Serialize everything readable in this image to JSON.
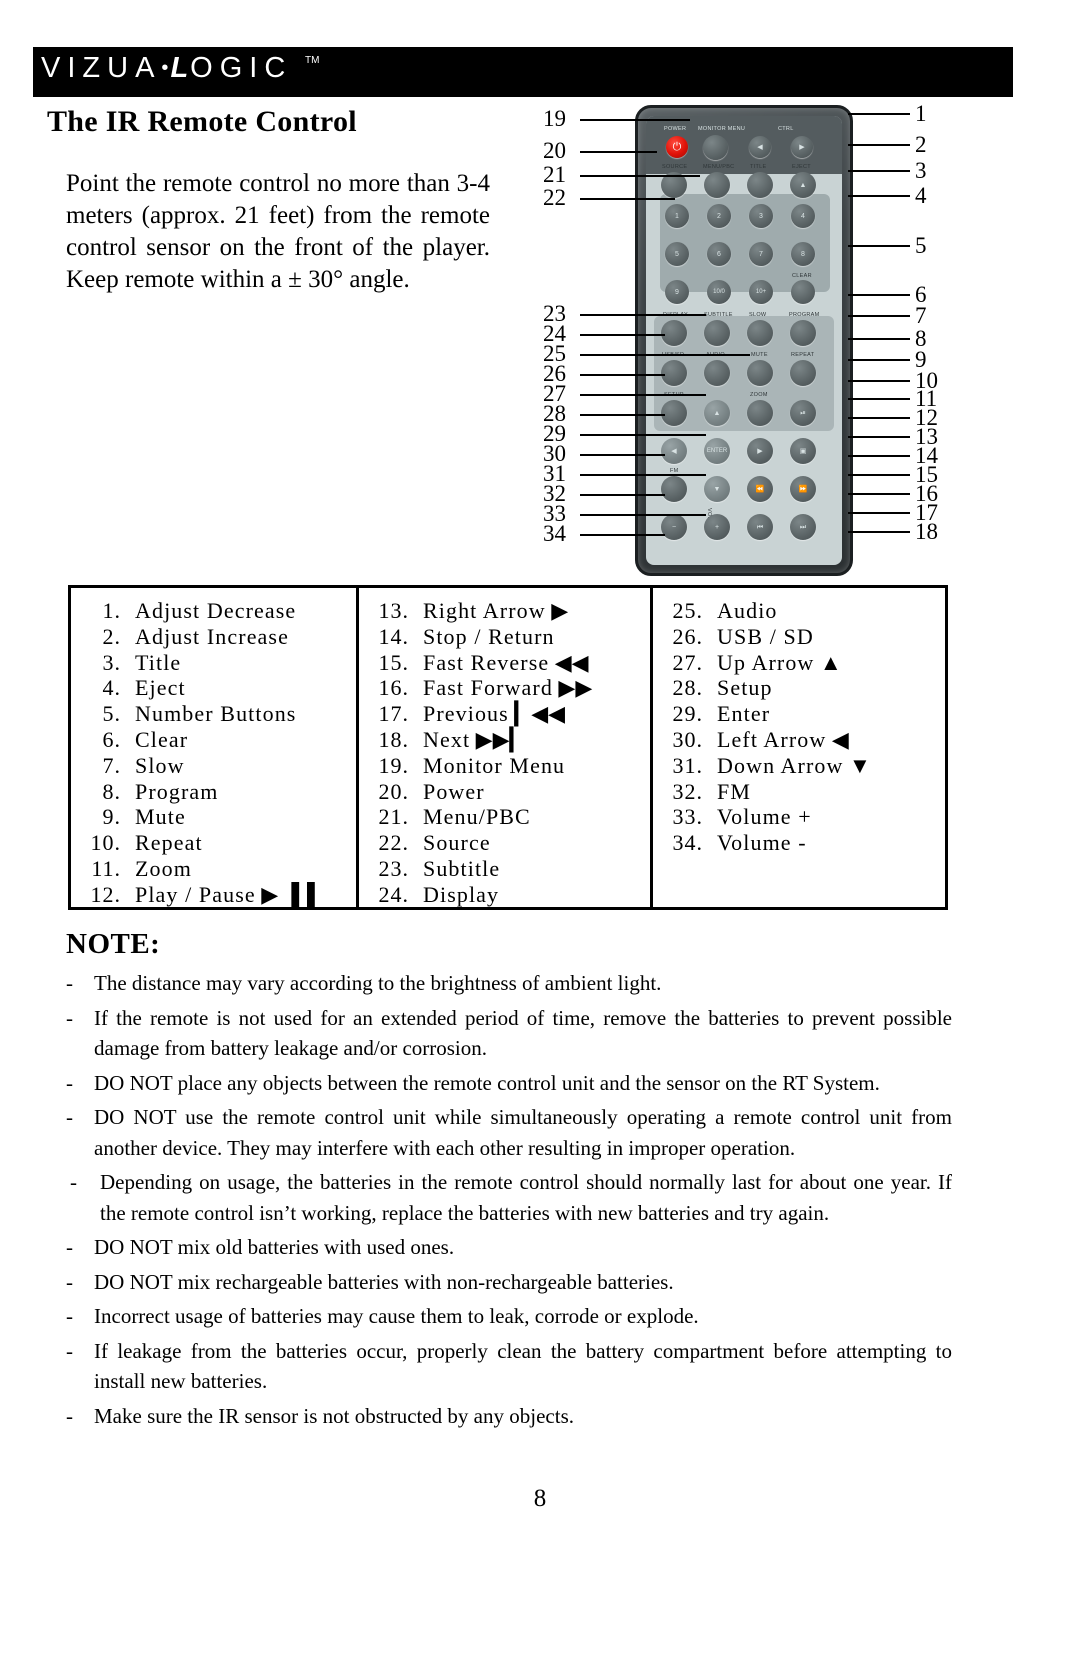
{
  "brand": {
    "logo_text": "V I Z U A L O G I C",
    "logo_letters": [
      "V",
      "I",
      "Z",
      "U",
      "A",
      "L",
      "O",
      "G",
      "I",
      "C"
    ],
    "trademark": "TM"
  },
  "header": {
    "title": "The IR Remote Control"
  },
  "intro": {
    "paragraph": "Point the remote control no more than 3-4 meters (approx. 21 feet) from the remote control sensor on the front of the player.  Keep remote within a ± 30° angle."
  },
  "diagram": {
    "name": "ir-remote-control-diagram",
    "right_callouts": [
      "1",
      "2",
      "3",
      "4",
      "5",
      "6",
      "7",
      "8",
      "9",
      "10",
      "11",
      "12",
      "13",
      "14",
      "15",
      "16",
      "17",
      "18"
    ],
    "left_callouts": [
      "19",
      "20",
      "21",
      "22",
      "23",
      "24",
      "25",
      "26",
      "27",
      "28",
      "29",
      "30",
      "31",
      "32",
      "33",
      "34"
    ],
    "button_labels": [
      "POWER",
      "MONITOR MENU",
      "CTRL",
      "SOURCE",
      "MENU/PBC",
      "TITLE",
      "EJECT",
      "CLEAR",
      "DISPLAY",
      "SUBTITLE",
      "SLOW",
      "PROGRAM",
      "USB/SD",
      "AUDIO",
      "MUTE",
      "REPEAT",
      "SETUP",
      "ZOOM",
      "ENTER",
      "FM",
      "VOL"
    ],
    "number_keys": [
      "1",
      "2",
      "3",
      "4",
      "5",
      "6",
      "7",
      "8",
      "9",
      "10/0",
      "10+"
    ]
  },
  "legend": {
    "columns": [
      {
        "items": [
          {
            "num": "1.",
            "label": "Adjust Decrease",
            "glyph": ""
          },
          {
            "num": "2.",
            "label": "Adjust Increase",
            "glyph": ""
          },
          {
            "num": "3.",
            "label": "Title",
            "glyph": ""
          },
          {
            "num": "4.",
            "label": "Eject",
            "glyph": ""
          },
          {
            "num": "5.",
            "label": "Number Buttons",
            "glyph": ""
          },
          {
            "num": "6.",
            "label": "Clear",
            "glyph": ""
          },
          {
            "num": "7.",
            "label": "Slow",
            "glyph": ""
          },
          {
            "num": "8.",
            "label": "Program",
            "glyph": ""
          },
          {
            "num": "9.",
            "label": "Mute",
            "glyph": ""
          },
          {
            "num": "10.",
            "label": "Repeat",
            "glyph": ""
          },
          {
            "num": "11.",
            "label": "Zoom",
            "glyph": ""
          },
          {
            "num": "12.",
            "label": "Play / Pause",
            "glyph": "▶ ▐▐"
          }
        ]
      },
      {
        "items": [
          {
            "num": "13.",
            "label": "Right Arrow",
            "glyph": "▶"
          },
          {
            "num": "14.",
            "label": "Stop / Return",
            "glyph": ""
          },
          {
            "num": "15.",
            "label": "Fast Reverse",
            "glyph": "◀◀"
          },
          {
            "num": "16.",
            "label": "Fast Forward",
            "glyph": "▶▶"
          },
          {
            "num": "17.",
            "label": "Previous",
            "glyph": "▎◀◀"
          },
          {
            "num": "18.",
            "label": "Next",
            "glyph": "▶▶▎"
          },
          {
            "num": "19.",
            "label": "Monitor Menu",
            "glyph": ""
          },
          {
            "num": "20.",
            "label": "Power",
            "glyph": ""
          },
          {
            "num": "21.",
            "label": "Menu/PBC",
            "glyph": ""
          },
          {
            "num": "22.",
            "label": "Source",
            "glyph": ""
          },
          {
            "num": "23.",
            "label": "Subtitle",
            "glyph": ""
          },
          {
            "num": "24.",
            "label": "Display",
            "glyph": ""
          }
        ]
      },
      {
        "items": [
          {
            "num": "25.",
            "label": "Audio",
            "glyph": ""
          },
          {
            "num": "26.",
            "label": "USB / SD",
            "glyph": ""
          },
          {
            "num": "27.",
            "label": "Up Arrow",
            "glyph": "▲"
          },
          {
            "num": "28.",
            "label": "Setup",
            "glyph": ""
          },
          {
            "num": "29.",
            "label": "Enter",
            "glyph": ""
          },
          {
            "num": "30.",
            "label": "Left Arrow",
            "glyph": "◀"
          },
          {
            "num": "31.",
            "label": "Down Arrow",
            "glyph": "▼"
          },
          {
            "num": "32.",
            "label": "FM",
            "glyph": ""
          },
          {
            "num": "33.",
            "label": "Volume +",
            "glyph": ""
          },
          {
            "num": "34.",
            "label": "Volume -",
            "glyph": ""
          }
        ]
      }
    ]
  },
  "note": {
    "heading": "NOTE:",
    "dash": "-",
    "items": [
      "The distance may vary according to the brightness of ambient light.",
      "If the remote is not used for an extended period of time, remove the batteries to prevent possible damage from battery leakage and/or corrosion.",
      "DO NOT place any objects between the remote control unit and the sensor on the RT System.",
      "DO NOT use the remote control unit while simultaneously operating a remote control unit from another device.  They may interfere with each other resulting in improper operation.",
      "Depending on usage, the batteries in the remote control should normally last for about one year. If the remote control isn’t working, replace the batteries with new batteries and try again.",
      "DO NOT mix old batteries with used ones.",
      "DO NOT mix rechargeable batteries with non-rechargeable batteries.",
      "Incorrect usage of batteries may cause them to leak, corrode or explode.",
      "If leakage from the batteries occur, properly clean the battery compartment before attempting to install new batteries.",
      "Make sure the IR sensor is not obstructed by any objects."
    ]
  },
  "footer": {
    "page_number": "8"
  }
}
